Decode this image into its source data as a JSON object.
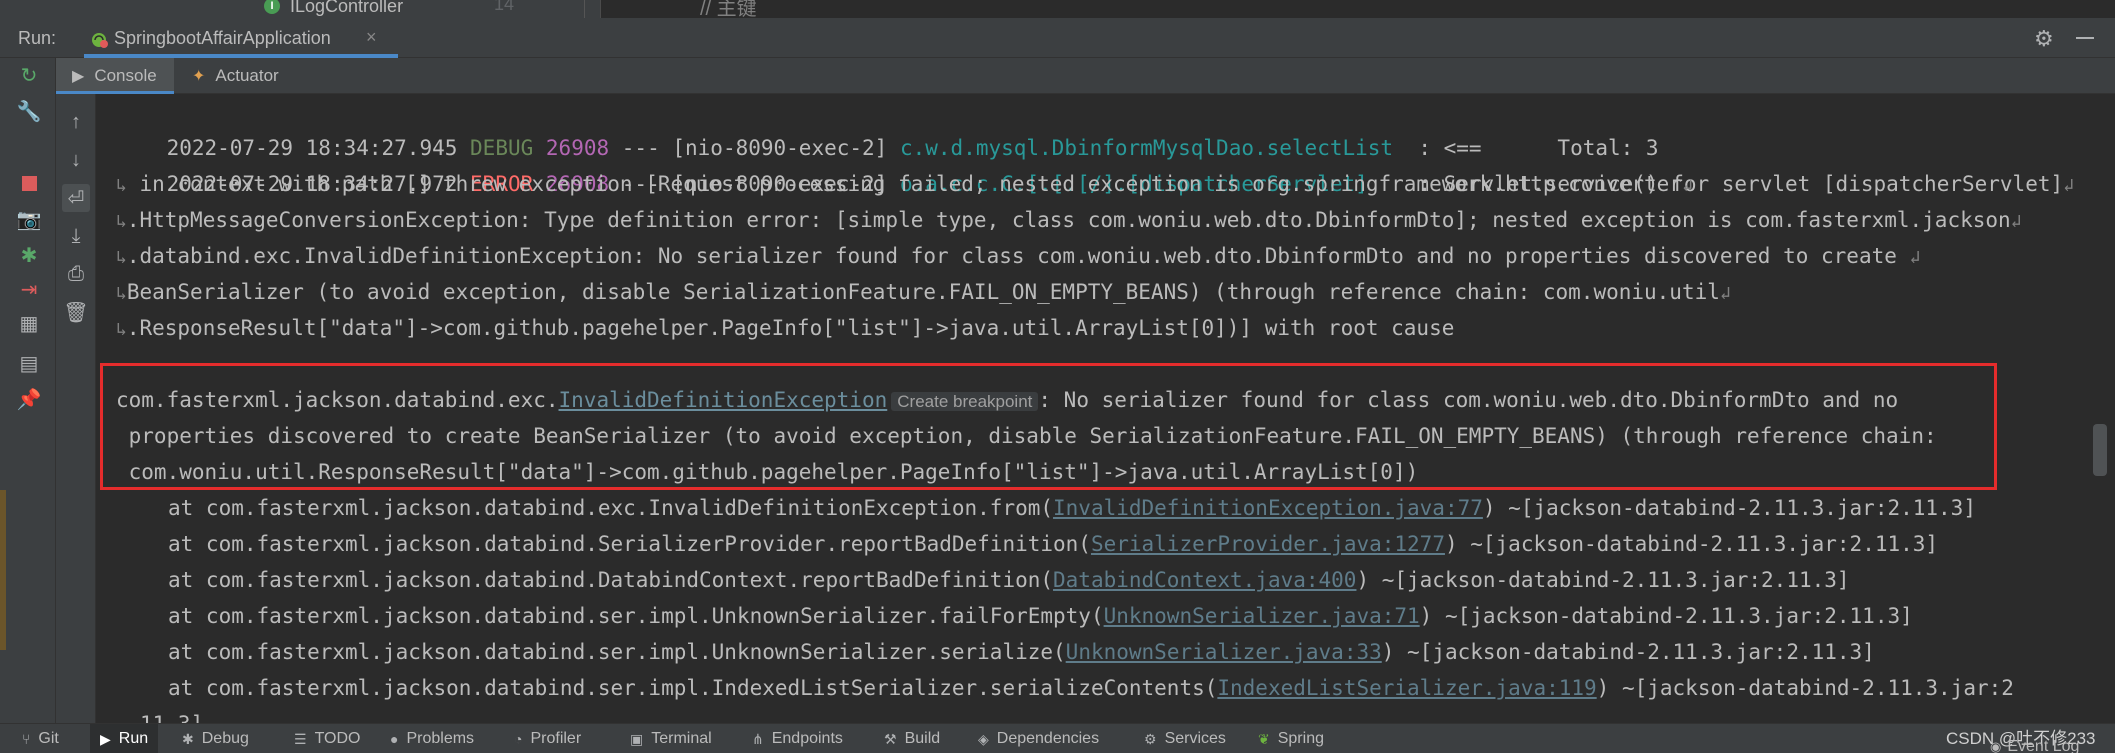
{
  "editor_residual": {
    "tree_item": "ILogController",
    "tree_icon_letter": "I",
    "line_number": "14",
    "code_snippet": "// 主键"
  },
  "run_panel": {
    "label": "Run:",
    "tab_title": "SpringbootAffairApplication",
    "tab_close": "×",
    "gear_icon": "gear-icon",
    "minimize_icon": "minimize-icon"
  },
  "console_tabs": [
    {
      "label": "Console",
      "icon": "console-icon",
      "active": true
    },
    {
      "label": "Actuator",
      "icon": "actuator-icon",
      "active": false
    }
  ],
  "log_lines": [
    {
      "date": "2022-07-29 18:34:27.945",
      "level": "DEBUG",
      "pid": "26908",
      "sep": "---",
      "thread": "[nio-8090-exec-2]",
      "logger": "c.w.d.mysql.DbinformMysqlDao.selectList",
      "message": "  : <==      Total: 3"
    },
    {
      "date": "2022-07-29 18:34:27.972",
      "level": "ERROR",
      "pid": "26908",
      "sep": "---",
      "thread": "[nio-8090-exec-2]",
      "logger": "o.a.c.c.C.[.[.[/].[dispatcherServlet]",
      "message": "    : Servlet.service() for servlet [dispatcherServlet]"
    }
  ],
  "wrapped_lines": [
    " in context with path [] threw exception [Request processing failed; nested exception is org.springframework.http.converter",
    ".HttpMessageConversionException: Type definition error: [simple type, class com.woniu.web.dto.DbinformDto]; nested exception is com.fasterxml.jackson",
    ".databind.exc.InvalidDefinitionException: No serializer found for class com.woniu.web.dto.DbinformDto and no properties discovered to create ",
    "BeanSerializer (to avoid exception, disable SerializationFeature.FAIL_ON_EMPTY_BEANS) (through reference chain: com.woniu.util",
    ".ResponseResult[\"data\"]->com.github.pagehelper.PageInfo[\"list\"]->java.util.ArrayList[0])] with root cause"
  ],
  "exception_block": {
    "prefix": "com.fasterxml.jackson.databind.exc.",
    "class_link": "InvalidDefinitionException",
    "breakpoint_hint": "Create breakpoint",
    "line1_rest": ": No serializer found for class com.woniu.web.dto.DbinformDto and no",
    "line2": " properties discovered to create BeanSerializer (to avoid exception, disable SerializationFeature.FAIL_ON_EMPTY_BEANS) (through reference chain:",
    "line3": " com.woniu.util.ResponseResult[\"data\"]->com.github.pagehelper.PageInfo[\"list\"]->java.util.ArrayList[0])"
  },
  "stack_trace": [
    {
      "method": "at com.fasterxml.jackson.databind.exc.InvalidDefinitionException.from(",
      "source": "InvalidDefinitionException.java:77",
      "tail": ") ~[jackson-databind-2.11.3.jar:2.11.3]"
    },
    {
      "method": "at com.fasterxml.jackson.databind.SerializerProvider.reportBadDefinition(",
      "source": "SerializerProvider.java:1277",
      "tail": ") ~[jackson-databind-2.11.3.jar:2.11.3]"
    },
    {
      "method": "at com.fasterxml.jackson.databind.DatabindContext.reportBadDefinition(",
      "source": "DatabindContext.java:400",
      "tail": ") ~[jackson-databind-2.11.3.jar:2.11.3]"
    },
    {
      "method": "at com.fasterxml.jackson.databind.ser.impl.UnknownSerializer.failForEmpty(",
      "source": "UnknownSerializer.java:71",
      "tail": ") ~[jackson-databind-2.11.3.jar:2.11.3]"
    },
    {
      "method": "at com.fasterxml.jackson.databind.ser.impl.UnknownSerializer.serialize(",
      "source": "UnknownSerializer.java:33",
      "tail": ") ~[jackson-databind-2.11.3.jar:2.11.3]"
    },
    {
      "method": "at com.fasterxml.jackson.databind.ser.impl.IndexedListSerializer.serializeContents(",
      "source": "IndexedListSerializer.java:119",
      "tail": ") ~[jackson-databind-2.11.3.jar:2"
    }
  ],
  "partial_last_line": "11.3]",
  "bottom_bar": [
    {
      "label": "Git",
      "icon": "git-icon"
    },
    {
      "label": "Run",
      "icon": "run-icon",
      "active": true
    },
    {
      "label": "Debug",
      "icon": "debug-icon"
    },
    {
      "label": "TODO",
      "icon": "todo-icon"
    },
    {
      "label": "Problems",
      "icon": "problems-icon"
    },
    {
      "label": "Profiler",
      "icon": "profiler-icon"
    },
    {
      "label": "Terminal",
      "icon": "terminal-icon"
    },
    {
      "label": "Endpoints",
      "icon": "endpoints-icon"
    },
    {
      "label": "Build",
      "icon": "build-icon"
    },
    {
      "label": "Dependencies",
      "icon": "dependencies-icon"
    },
    {
      "label": "Services",
      "icon": "services-icon"
    },
    {
      "label": "Spring",
      "icon": "spring-icon"
    }
  ],
  "event_log": "Event Log",
  "watermark": "CSDN @吐不修233",
  "colors": {
    "accent": "#4a88c7",
    "debug": "#6a8759",
    "error": "#ff6b68",
    "pid": "#b467b4",
    "logger": "#299999",
    "highlight": "#e52c2c"
  }
}
